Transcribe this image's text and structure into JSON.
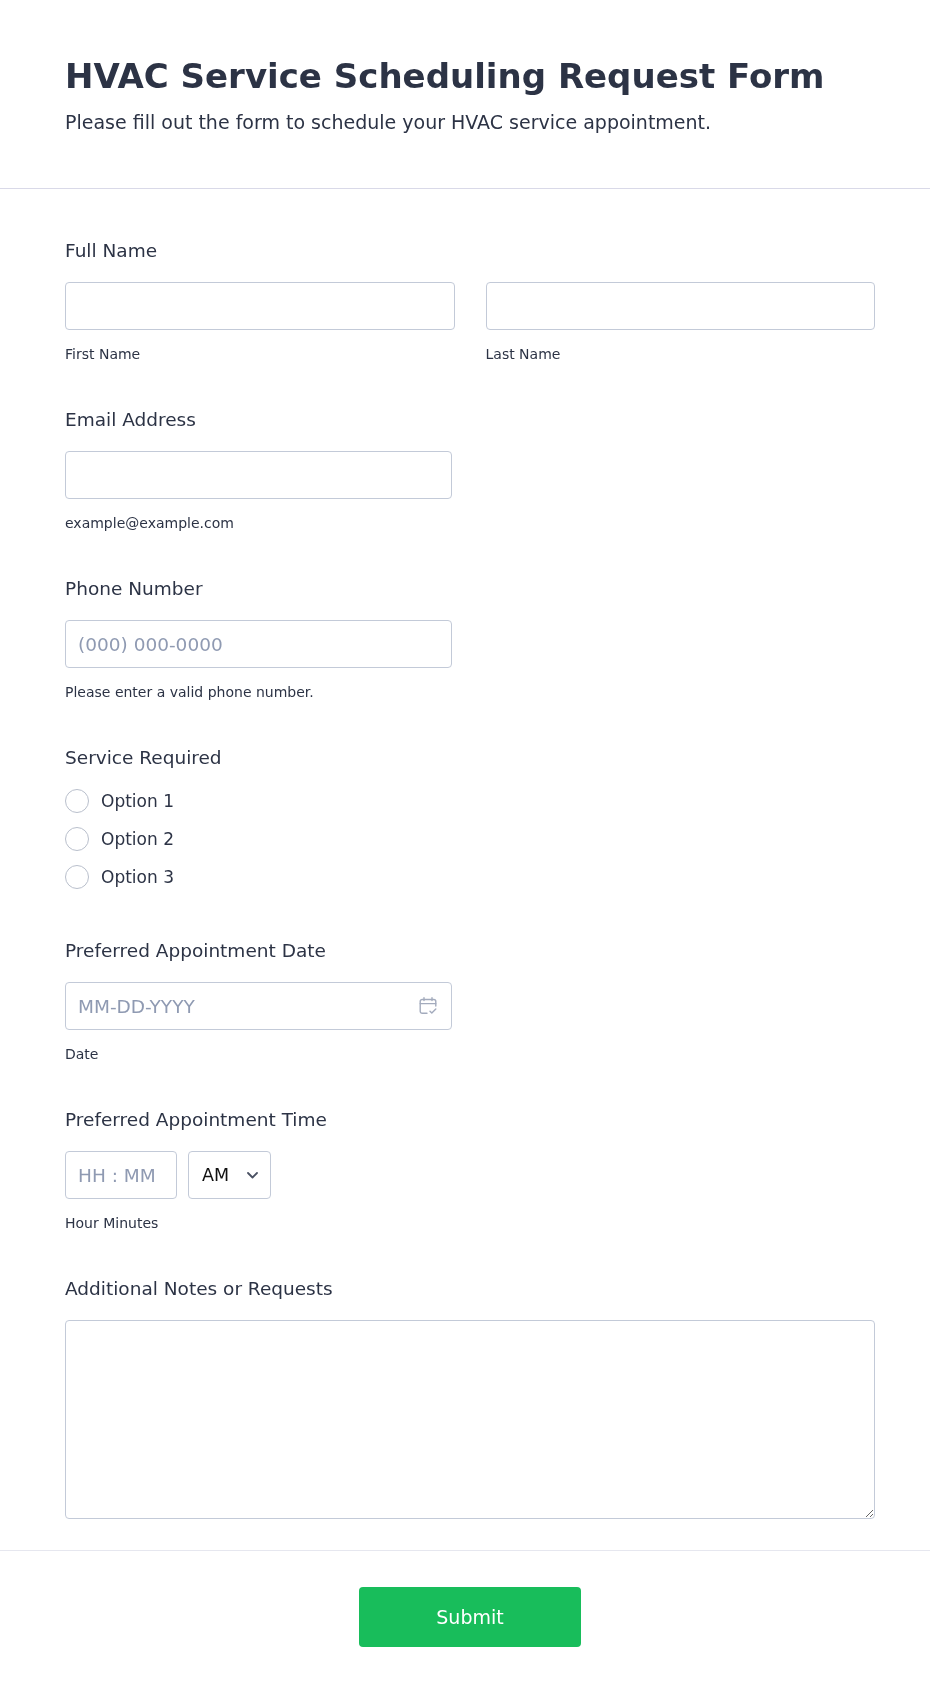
{
  "header": {
    "title": "HVAC Service Scheduling Request Form",
    "subtitle": "Please fill out the form to schedule your HVAC service appointment."
  },
  "fields": [
    {
      "kind": "split",
      "label": "Full Name",
      "parts": [
        {
          "caption": "First Name"
        },
        {
          "caption": "Last Name"
        }
      ]
    },
    {
      "kind": "text",
      "label": "Email Address",
      "caption": "example@example.com"
    },
    {
      "kind": "text",
      "label": "Phone Number",
      "placeholder": "(000) 000-0000",
      "caption": "Please enter a valid phone number."
    },
    {
      "kind": "radio",
      "label": "Service Required",
      "options": [
        {
          "label": "Option 1",
          "selected": false
        },
        {
          "label": "Option 2",
          "selected": false
        },
        {
          "label": "Option 3",
          "selected": false
        }
      ]
    },
    {
      "kind": "date",
      "label": "Preferred Appointment Date",
      "placeholder": "MM-DD-YYYY",
      "caption": "Date"
    },
    {
      "kind": "time",
      "label": "Preferred Appointment Time",
      "placeholder": "HH : MM",
      "period": "AM",
      "caption": "Hour Minutes"
    },
    {
      "kind": "textarea",
      "label": "Additional Notes or Requests"
    }
  ],
  "submit": {
    "label": "Submit"
  }
}
